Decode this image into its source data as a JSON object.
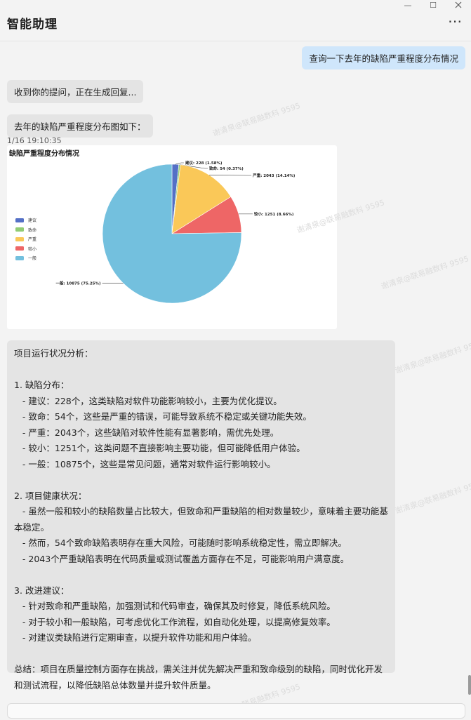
{
  "window": {
    "minimize": "—",
    "maximize": "☐"
  },
  "header": {
    "title": "智能助理",
    "more": "⋯"
  },
  "messages": {
    "user_query": "查询一下去年的缺陷严重程度分布情况",
    "bot_reply_1": "收到你的提问，正在生成回复...",
    "bot_reply_2": "去年的缺陷严重程度分布图如下：",
    "timestamp": "1/16 19:10:35"
  },
  "chart_data": {
    "type": "pie",
    "title": "缺陷严重程度分布情况",
    "legend_position": "left",
    "slices": [
      {
        "name": "建议",
        "value": 228,
        "label": "建议: 228 (1.58%)",
        "color": "#5470c6"
      },
      {
        "name": "致命",
        "value": 54,
        "label": "致命: 54 (0.37%)",
        "color": "#91cc75"
      },
      {
        "name": "严重",
        "value": 2043,
        "label": "严重: 2043 (14.14%)",
        "color": "#fac858"
      },
      {
        "name": "较小",
        "value": 1251,
        "label": "较小: 1251 (8.66%)",
        "color": "#ee6666"
      },
      {
        "name": "一般",
        "value": 10875,
        "label": "一般: 10875 (75.25%)",
        "color": "#73c0de"
      }
    ]
  },
  "analysis": {
    "heading": "项目运行状况分析：",
    "section1_title": "1. 缺陷分布：",
    "s1_l1": "   - 建议：228个，这类缺陷对软件功能影响较小，主要为优化提议。",
    "s1_l2": "   - 致命：54个，这些是严重的错误，可能导致系统不稳定或关键功能失效。",
    "s1_l3": "   - 严重：2043个，这些缺陷对软件性能有显著影响，需优先处理。",
    "s1_l4": "   - 较小：1251个，这类问题不直接影响主要功能，但可能降低用户体验。",
    "s1_l5": "   - 一般：10875个，这些是常见问题，通常对软件运行影响较小。",
    "section2_title": "2. 项目健康状况：",
    "s2_l1": "   - 虽然一般和较小的缺陷数量占比较大，但致命和严重缺陷的相对数量较少，意味着主要功能基本稳定。",
    "s2_l2": "   - 然而，54个致命缺陷表明存在重大风险，可能随时影响系统稳定性，需立即解决。",
    "s2_l3": "   - 2043个严重缺陷表明在代码质量或测试覆盖方面存在不足，可能影响用户满意度。",
    "section3_title": "3. 改进建议：",
    "s3_l1": "   - 针对致命和严重缺陷，加强测试和代码审查，确保其及时修复，降低系统风险。",
    "s3_l2": "   - 对于较小和一般缺陷，可考虑优化工作流程，如自动化处理，以提高修复效率。",
    "s3_l3": "   - 对建议类缺陷进行定期审查，以提升软件功能和用户体验。",
    "summary": "总结：项目在质量控制方面存在挑战，需关注并优先解决严重和致命级别的缺陷，同时优化开发和测试流程，以降低缺陷总体数量并提升软件质量。"
  },
  "watermark": "谢清泉@联易融数科 9595"
}
